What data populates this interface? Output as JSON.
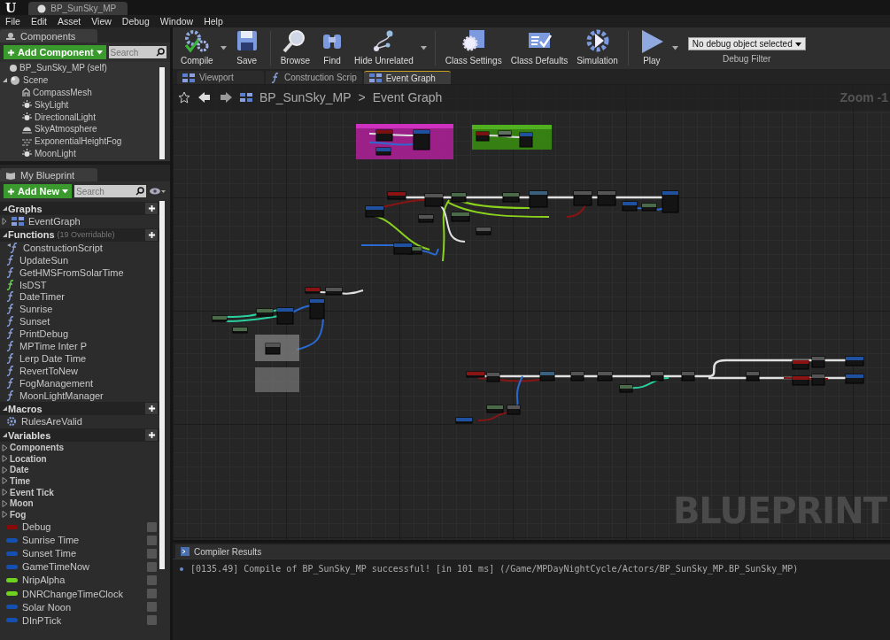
{
  "window": {
    "app_logo": "U",
    "title": "BP_SunSky_MP"
  },
  "menu": [
    "File",
    "Edit",
    "Asset",
    "View",
    "Debug",
    "Window",
    "Help"
  ],
  "components": {
    "tab": "Components",
    "add_button": "Add Component",
    "search": {
      "placeholder": "Search"
    },
    "tree": [
      {
        "label": "BP_SunSky_MP (self)",
        "kind": "self"
      },
      {
        "label": "Scene",
        "kind": "scene",
        "expanded": true,
        "children": [
          {
            "label": "CompassMesh",
            "kind": "mesh"
          },
          {
            "label": "SkyLight",
            "kind": "light"
          },
          {
            "label": "DirectionalLight",
            "kind": "light"
          },
          {
            "label": "SkyAtmosphere",
            "kind": "atmosphere"
          },
          {
            "label": "ExponentialHeightFog",
            "kind": "fog"
          },
          {
            "label": "MoonLight",
            "kind": "light"
          }
        ]
      }
    ]
  },
  "my_blueprint": {
    "tab": "My Blueprint",
    "add_button": "Add New",
    "search": {
      "placeholder": "Search"
    },
    "sections": [
      {
        "title": "Graphs",
        "expanded": true,
        "items": [
          {
            "label": "EventGraph",
            "kind": "graph"
          }
        ]
      },
      {
        "title": "Functions",
        "note": "(19 Overridable)",
        "expanded": true,
        "items": [
          {
            "label": "ConstructionScript",
            "kind": "construction"
          },
          {
            "label": "UpdateSun",
            "kind": "function"
          },
          {
            "label": "GetHMSFromSolarTime",
            "kind": "function"
          },
          {
            "label": "IsDST",
            "kind": "pure"
          },
          {
            "label": "DateTimer",
            "kind": "function"
          },
          {
            "label": "Sunrise",
            "kind": "function"
          },
          {
            "label": "Sunset",
            "kind": "function"
          },
          {
            "label": "PrintDebug",
            "kind": "function"
          },
          {
            "label": "MPTime Inter P",
            "kind": "function"
          },
          {
            "label": "Lerp Date Time",
            "kind": "function"
          },
          {
            "label": "RevertToNew",
            "kind": "function"
          },
          {
            "label": "FogManagement",
            "kind": "function"
          },
          {
            "label": "MoonLightManager",
            "kind": "function"
          }
        ]
      },
      {
        "title": "Macros",
        "expanded": true,
        "items": [
          {
            "label": "RulesAreValid",
            "kind": "macro"
          }
        ]
      },
      {
        "title": "Variables",
        "expanded": true,
        "items": [
          {
            "label": "Components",
            "kind": "category",
            "expanded": false
          },
          {
            "label": "Location",
            "kind": "category",
            "expanded": false
          },
          {
            "label": "Date",
            "kind": "category",
            "expanded": false
          },
          {
            "label": "Time",
            "kind": "category",
            "expanded": false
          },
          {
            "label": "Event Tick",
            "kind": "category",
            "expanded": false
          },
          {
            "label": "Moon",
            "kind": "category",
            "expanded": false
          },
          {
            "label": "Fog",
            "kind": "category",
            "expanded": false
          },
          {
            "label": "Debug",
            "kind": "variable",
            "color": "#8a0a0a"
          },
          {
            "label": "Sunrise Time",
            "kind": "variable",
            "color": "#1450b4"
          },
          {
            "label": "Sunset Time",
            "kind": "variable",
            "color": "#1450b4"
          },
          {
            "label": "GameTimeNow",
            "kind": "variable",
            "color": "#1450b4"
          },
          {
            "label": "NripAlpha",
            "kind": "variable",
            "color": "#6ed21e"
          },
          {
            "label": "DNRChangeTimeClock",
            "kind": "variable",
            "color": "#6ed21e"
          },
          {
            "label": "Solar Noon",
            "kind": "variable",
            "color": "#1450b4"
          },
          {
            "label": "DInPTick",
            "kind": "variable",
            "color": "#1450b4"
          }
        ]
      }
    ]
  },
  "toolbar": {
    "buttons": [
      {
        "label": "Compile",
        "kind": "compile",
        "menu": true
      },
      {
        "label": "Save",
        "kind": "save"
      },
      {
        "label": "Browse",
        "kind": "browse"
      },
      {
        "label": "Find",
        "kind": "find"
      },
      {
        "label": "Hide Unrelated",
        "kind": "hide",
        "menu": true
      },
      {
        "label": "Class Settings",
        "kind": "settings"
      },
      {
        "label": "Class Defaults",
        "kind": "defaults"
      },
      {
        "label": "Simulation",
        "kind": "simulation"
      },
      {
        "label": "Play",
        "kind": "play",
        "menu": true
      }
    ],
    "debug_filter": {
      "value": "No debug object selected",
      "label": "Debug Filter"
    }
  },
  "editor_tabs": [
    {
      "label": "Viewport",
      "kind": "viewport",
      "selected": false
    },
    {
      "label": "Construction Scrip",
      "kind": "function",
      "selected": false
    },
    {
      "label": "Event Graph",
      "kind": "graph",
      "selected": true
    }
  ],
  "breadcrumb": {
    "blueprint": "BP_SunSky_MP",
    "separator": ">",
    "graph": "Event Graph",
    "zoom": "Zoom -1"
  },
  "graph": {
    "watermark": "BLUEPRINT"
  },
  "compiler_results": {
    "tab": "Compiler Results",
    "messages": [
      "[0135.49] Compile of BP_SunSky_MP successful! [in 101 ms] (/Game/MPDayNightCycle/Actors/BP_SunSky_MP.BP_SunSky_MP)"
    ]
  }
}
